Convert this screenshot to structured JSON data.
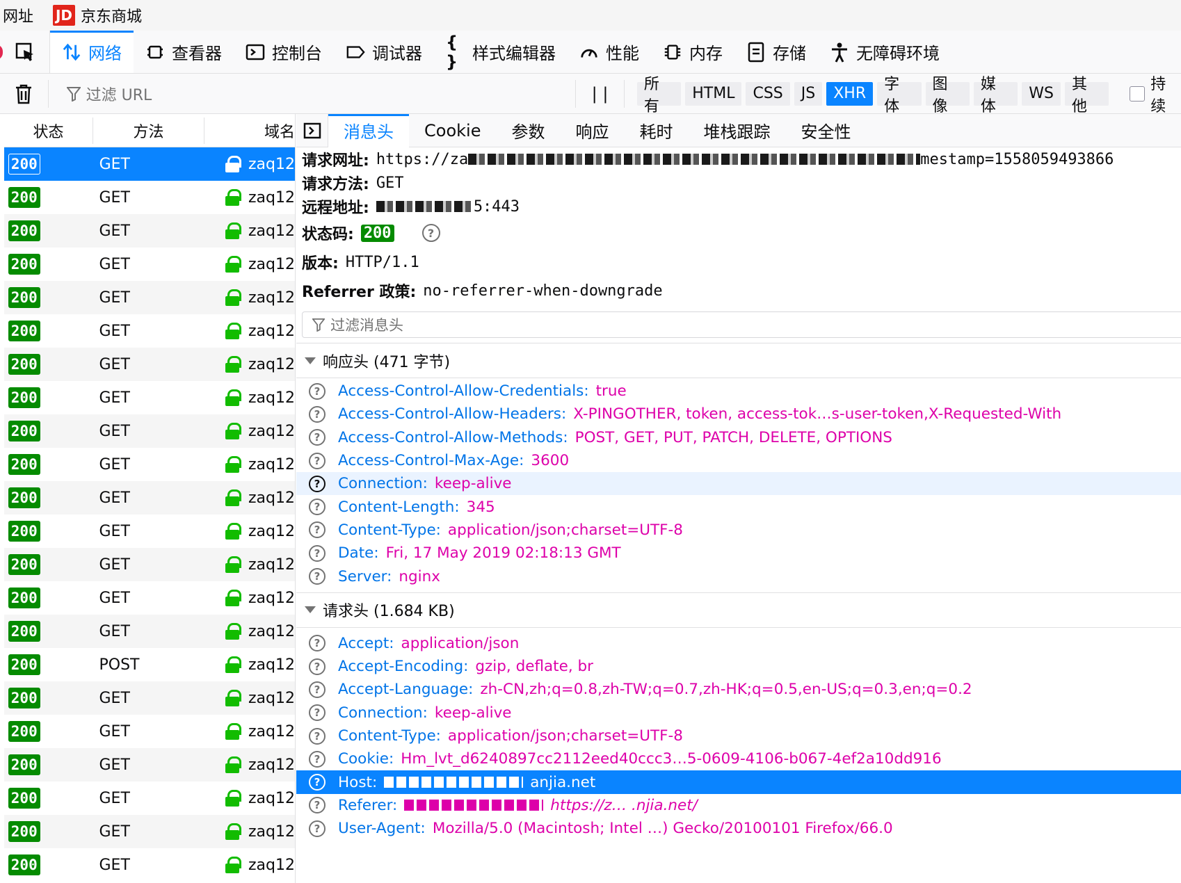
{
  "address_bar": {
    "label": "网址",
    "logo": "JD",
    "site_title": "京东商城"
  },
  "toolbar": {
    "tabs": [
      {
        "label": "网络",
        "icon": "network-arrows-icon"
      },
      {
        "label": "查看器",
        "icon": "inspector-icon"
      },
      {
        "label": "控制台",
        "icon": "console-icon"
      },
      {
        "label": "调试器",
        "icon": "debugger-icon"
      },
      {
        "label": "样式编辑器",
        "icon": "braces-icon"
      },
      {
        "label": "性能",
        "icon": "gauge-icon"
      },
      {
        "label": "内存",
        "icon": "chip-icon"
      },
      {
        "label": "存储",
        "icon": "storage-icon"
      },
      {
        "label": "无障碍环境",
        "icon": "accessibility-icon"
      }
    ]
  },
  "filter_bar": {
    "placeholder": "过滤 URL",
    "pause": "| |",
    "types": [
      "所有",
      "HTML",
      "CSS",
      "JS",
      "XHR",
      "字体",
      "图像",
      "媒体",
      "WS",
      "其他"
    ],
    "selected_type": "XHR",
    "persist_label": "持续"
  },
  "request_list": {
    "columns": [
      "状态",
      "方法",
      "域名"
    ],
    "rows": [
      {
        "status": "200",
        "method": "GET",
        "domain": "zaq12"
      },
      {
        "status": "200",
        "method": "GET",
        "domain": "zaq12"
      },
      {
        "status": "200",
        "method": "GET",
        "domain": "zaq12"
      },
      {
        "status": "200",
        "method": "GET",
        "domain": "zaq12"
      },
      {
        "status": "200",
        "method": "GET",
        "domain": "zaq12"
      },
      {
        "status": "200",
        "method": "GET",
        "domain": "zaq12"
      },
      {
        "status": "200",
        "method": "GET",
        "domain": "zaq12"
      },
      {
        "status": "200",
        "method": "GET",
        "domain": "zaq12"
      },
      {
        "status": "200",
        "method": "GET",
        "domain": "zaq12"
      },
      {
        "status": "200",
        "method": "GET",
        "domain": "zaq12"
      },
      {
        "status": "200",
        "method": "GET",
        "domain": "zaq12"
      },
      {
        "status": "200",
        "method": "GET",
        "domain": "zaq12"
      },
      {
        "status": "200",
        "method": "GET",
        "domain": "zaq12"
      },
      {
        "status": "200",
        "method": "GET",
        "domain": "zaq12"
      },
      {
        "status": "200",
        "method": "GET",
        "domain": "zaq12"
      },
      {
        "status": "200",
        "method": "POST",
        "domain": "zaq12"
      },
      {
        "status": "200",
        "method": "GET",
        "domain": "zaq12"
      },
      {
        "status": "200",
        "method": "GET",
        "domain": "zaq12"
      },
      {
        "status": "200",
        "method": "GET",
        "domain": "zaq12"
      },
      {
        "status": "200",
        "method": "GET",
        "domain": "zaq12"
      },
      {
        "status": "200",
        "method": "GET",
        "domain": "zaq12"
      },
      {
        "status": "200",
        "method": "GET",
        "domain": "zaq12"
      }
    ]
  },
  "detail": {
    "tabs": [
      "消息头",
      "Cookie",
      "参数",
      "响应",
      "耗时",
      "堆栈跟踪",
      "安全性"
    ],
    "summary": {
      "url_label": "请求网址:",
      "url_prefix": "https://za",
      "url_suffix": "mestamp=1558059493866",
      "method_label": "请求方法:",
      "method": "GET",
      "remote_label": "远程地址:",
      "remote_suffix": "5:443",
      "status_label": "状态码:",
      "status": "200",
      "version_label": "版本:",
      "version": "HTTP/1.1",
      "referrer_label": "Referrer 政策:",
      "referrer": "no-referrer-when-downgrade"
    },
    "filter_placeholder": "过滤消息头",
    "response_headers_title": "响应头 (471 字节)",
    "response_headers": [
      {
        "name": "Access-Control-Allow-Credentials:",
        "value": "true"
      },
      {
        "name": "Access-Control-Allow-Headers:",
        "value": "X-PINGOTHER, token, access-tok…s-user-token,X-Requested-With"
      },
      {
        "name": "Access-Control-Allow-Methods:",
        "value": "POST, GET, PUT, PATCH, DELETE, OPTIONS"
      },
      {
        "name": "Access-Control-Max-Age:",
        "value": "3600"
      },
      {
        "name": "Connection:",
        "value": "keep-alive"
      },
      {
        "name": "Content-Length:",
        "value": "345"
      },
      {
        "name": "Content-Type:",
        "value": "application/json;charset=UTF-8"
      },
      {
        "name": "Date:",
        "value": "Fri, 17 May 2019 02:18:13 GMT"
      },
      {
        "name": "Server:",
        "value": "nginx"
      }
    ],
    "request_headers_title": "请求头 (1.684 KB)",
    "request_headers": [
      {
        "name": "Accept:",
        "value": "application/json"
      },
      {
        "name": "Accept-Encoding:",
        "value": "gzip, deflate, br"
      },
      {
        "name": "Accept-Language:",
        "value": "zh-CN,zh;q=0.8,zh-TW;q=0.7,zh-HK;q=0.5,en-US;q=0.3,en;q=0.2"
      },
      {
        "name": "Connection:",
        "value": "keep-alive"
      },
      {
        "name": "Content-Type:",
        "value": "application/json;charset=UTF-8"
      },
      {
        "name": "Cookie:",
        "value": "Hm_lvt_d6240897cc2112eed40ccc3…5-0609-4106-b067-4ef2a10dd916"
      },
      {
        "name": "Host:",
        "value": "anjia.net"
      },
      {
        "name": "Referer:",
        "value": "https://z… .njia.net/"
      },
      {
        "name": "User-Agent:",
        "value": "Mozilla/5.0 (Macintosh; Intel …) Gecko/20100101 Firefox/66.0"
      }
    ]
  },
  "colors": {
    "accent": "#0a84ff",
    "status_ok": "#058b00",
    "header_name": "#0074e8",
    "header_value": "#dd00a9"
  }
}
